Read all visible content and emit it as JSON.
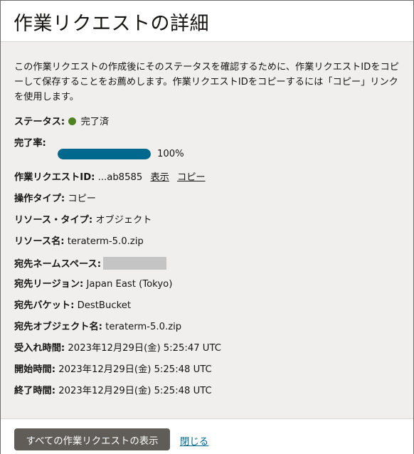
{
  "header": {
    "title": "作業リクエストの詳細"
  },
  "intro": "この作業リクエストの作成後にそのステータスを確認するために、作業リクエストIDをコピーして保存することをお薦めします。作業リクエストIDをコピーするには「コピー」リンクを使用します。",
  "details": {
    "status": {
      "label": "ステータス:",
      "value": "完了済",
      "color": "#508223"
    },
    "progress": {
      "label": "完了率:",
      "value": 100,
      "text": "100%",
      "color": "#00688c"
    },
    "request_id": {
      "label": "作業リクエストID:",
      "value": "...ab8585",
      "show_link": "表示",
      "copy_link": "コピー"
    },
    "operation_type": {
      "label": "操作タイプ:",
      "value": "コピー"
    },
    "resource_type": {
      "label": "リソース・タイプ:",
      "value": "オブジェクト"
    },
    "resource_name": {
      "label": "リソース名:",
      "value": "teraterm-5.0.zip"
    },
    "dest_namespace": {
      "label": "宛先ネームスペース:"
    },
    "dest_region": {
      "label": "宛先リージョン:",
      "value": "Japan East (Tokyo)"
    },
    "dest_bucket": {
      "label": "宛先バケット:",
      "value": "DestBucket"
    },
    "dest_object": {
      "label": "宛先オブジェクト名:",
      "value": "teraterm-5.0.zip"
    },
    "accepted_time": {
      "label": "受入れ時間:",
      "value": "2023年12月29日(金) 5:25:47 UTC"
    },
    "start_time": {
      "label": "開始時間:",
      "value": "2023年12月29日(金) 5:25:48 UTC"
    },
    "end_time": {
      "label": "終了時間:",
      "value": "2023年12月29日(金) 5:25:48 UTC"
    }
  },
  "footer": {
    "view_all_button": "すべての作業リクエストの表示",
    "close_link": "閉じる"
  }
}
